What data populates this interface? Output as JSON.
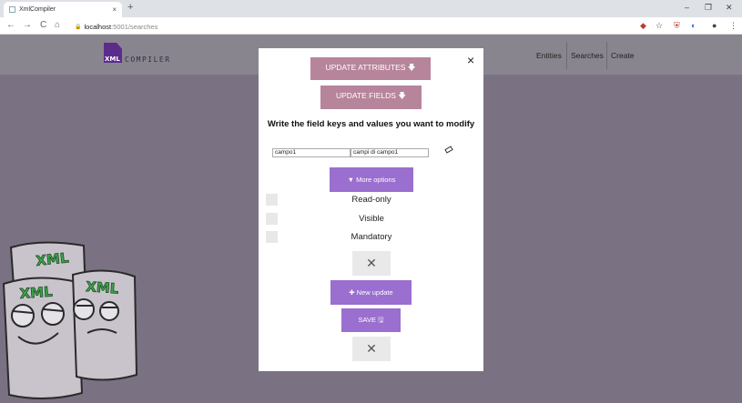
{
  "browser": {
    "tab_title": "XmlCompiler",
    "url_host": "localhost",
    "url_path": ":5001/searches",
    "new_tab": "+",
    "tab_close": "×",
    "back": "←",
    "forward": "→",
    "reload": "C",
    "home": "⌂",
    "lock": "🔒",
    "minimize": "–",
    "maximize": "❐",
    "close": "✕",
    "star": "☆",
    "menu": "⋮"
  },
  "app": {
    "logo_xml": "XML",
    "logo_text": "COMPILER",
    "nav": [
      "Entities",
      "Searches",
      "Create"
    ]
  },
  "mascots": {
    "label": "XML"
  },
  "modal": {
    "close": "×",
    "update_attributes": "UPDATE ATTRIBUTES 🡇",
    "update_fields": "UPDATE FIELDS 🡇",
    "heading": "Write the field keys and values you want to modify",
    "key_value": "campo1",
    "value_value": "campi di campo1",
    "more_options": "▼ More options",
    "options": [
      "Read-only",
      "Visible",
      "Mandatory"
    ],
    "remove": "✕",
    "new_update": "✚ New update",
    "save": "SAVE 🖫",
    "remove2": "✕"
  },
  "colors": {
    "rose": "#b7859b",
    "violet": "#9a6fcf",
    "overlay": "#7a7282"
  }
}
